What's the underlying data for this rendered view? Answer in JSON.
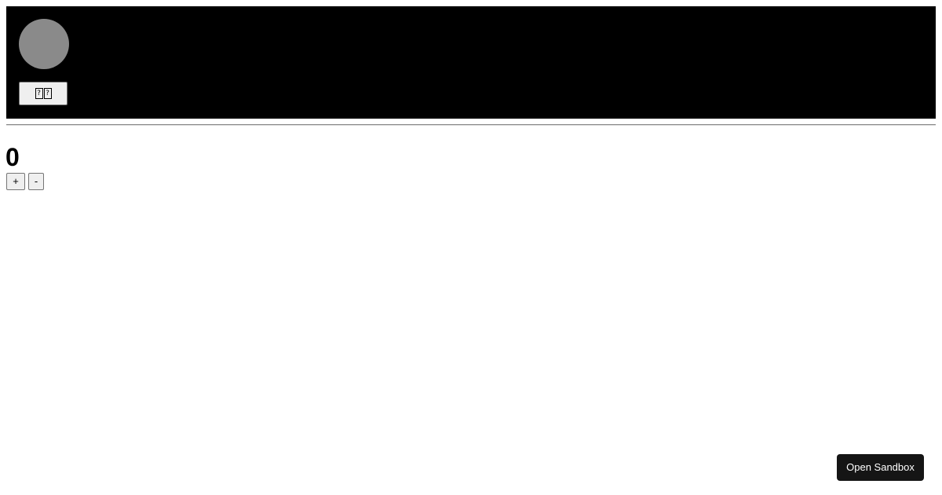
{
  "header": {
    "avatar_color": "#8a8a8a",
    "background_color": "#000000",
    "button": {
      "icon_names": [
        "missing-glyph-icon",
        "missing-glyph-icon"
      ]
    }
  },
  "counter": {
    "value": "0",
    "increment_label": "+",
    "decrement_label": "-"
  },
  "sandbox": {
    "button_label": "Open Sandbox"
  }
}
